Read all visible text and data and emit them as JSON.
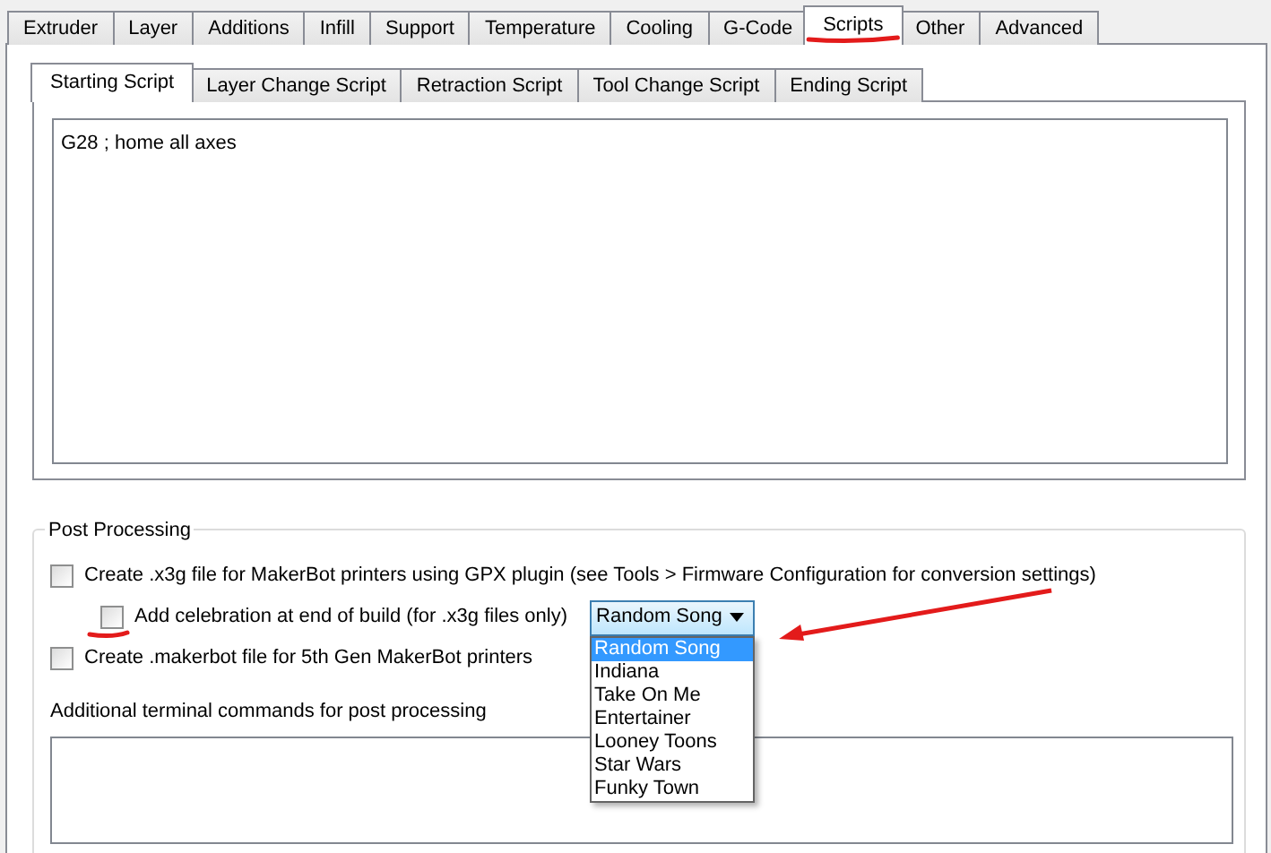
{
  "tabs": [
    {
      "label": "Extruder",
      "selected": false,
      "annotated": false
    },
    {
      "label": "Layer",
      "selected": false,
      "annotated": false
    },
    {
      "label": "Additions",
      "selected": false,
      "annotated": false
    },
    {
      "label": "Infill",
      "selected": false,
      "annotated": false
    },
    {
      "label": "Support",
      "selected": false,
      "annotated": false
    },
    {
      "label": "Temperature",
      "selected": false,
      "annotated": false
    },
    {
      "label": "Cooling",
      "selected": false,
      "annotated": false
    },
    {
      "label": "G-Code",
      "selected": false,
      "annotated": false
    },
    {
      "label": "Scripts",
      "selected": true,
      "annotated": true
    },
    {
      "label": "Other",
      "selected": false,
      "annotated": false
    },
    {
      "label": "Advanced",
      "selected": false,
      "annotated": false
    }
  ],
  "script_tabs": [
    {
      "label": "Starting Script",
      "selected": true
    },
    {
      "label": "Layer Change Script",
      "selected": false
    },
    {
      "label": "Retraction Script",
      "selected": false
    },
    {
      "label": "Tool Change Script",
      "selected": false
    },
    {
      "label": "Ending Script",
      "selected": false
    }
  ],
  "script_text": "G28 ; home all axes",
  "post_processing": {
    "title": "Post Processing",
    "options": [
      {
        "kind": "checkbox",
        "label": "Create .x3g file for MakerBot printers using GPX plugin (see Tools > Firmware Configuration for conversion settings)",
        "checked": false,
        "annotated": false
      },
      {
        "kind": "sub_checkbox",
        "label": "Add celebration at end of build (for .x3g files only)",
        "checked": false,
        "annotated": true,
        "select": {
          "value": "Random Song",
          "expanded": true,
          "annotated": true,
          "items": [
            {
              "label": "Random Song",
              "selected": true
            },
            {
              "label": "Indiana",
              "selected": false
            },
            {
              "label": "Take On Me",
              "selected": false
            },
            {
              "label": "Entertainer",
              "selected": false
            },
            {
              "label": "Looney Toons",
              "selected": false
            },
            {
              "label": "Star Wars",
              "selected": false
            },
            {
              "label": "Funky Town",
              "selected": false
            }
          ]
        }
      },
      {
        "kind": "checkbox",
        "label": "Create .makerbot file for 5th Gen MakerBot printers",
        "checked": false,
        "annotated": false
      }
    ],
    "terminal_label": "Additional terminal commands for post processing"
  }
}
